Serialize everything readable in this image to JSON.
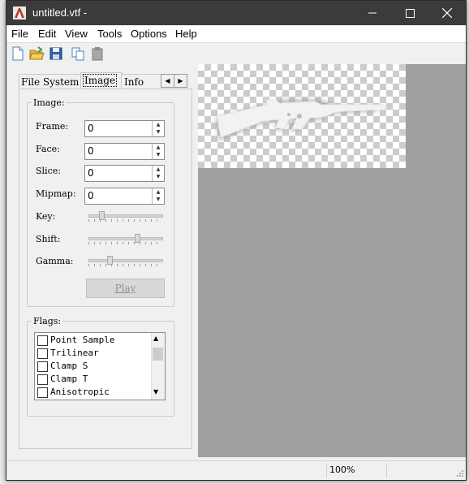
{
  "window": {
    "title": "untitled.vtf -",
    "controls": {
      "minimize": "minimize-icon",
      "maximize": "maximize-icon",
      "close": "close-icon"
    }
  },
  "menu": {
    "items": [
      "File",
      "Edit",
      "View",
      "Tools",
      "Options",
      "Help"
    ]
  },
  "toolbar": {
    "icons": [
      "new-file-icon",
      "open-folder-icon",
      "save-icon",
      "copy-icon",
      "paste-icon"
    ]
  },
  "tabs": {
    "items": [
      "File System",
      "Image",
      "Info"
    ],
    "active": "Image"
  },
  "image_group": {
    "label": "Image:",
    "frame_label": "Frame:",
    "frame_value": "0",
    "face_label": "Face:",
    "face_value": "0",
    "slice_label": "Slice:",
    "slice_value": "0",
    "mipmap_label": "Mipmap:",
    "mipmap_value": "0",
    "key_label": "Key:",
    "key_level": 0.15,
    "shift_label": "Shift:",
    "shift_level": 0.68,
    "gamma_label": "Gamma:",
    "gamma_level": 0.27,
    "play_label": "Play"
  },
  "flags_group": {
    "label": "Flags:",
    "items": [
      "Point Sample",
      "Trilinear",
      "Clamp S",
      "Clamp T",
      "Anisotropic"
    ]
  },
  "status": {
    "zoom": "100%"
  },
  "colors": {
    "titlebar": "#3b3b3b",
    "canvas_bg": "#a0a0a0"
  }
}
